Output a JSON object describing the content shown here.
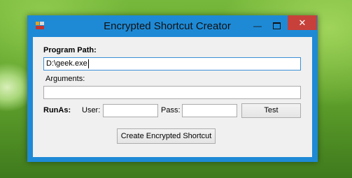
{
  "window": {
    "title": "Encrypted Shortcut Creator",
    "minimize_glyph": "—",
    "close_glyph": "✕",
    "accent_color": "#1e8ad6",
    "close_color": "#c7403a"
  },
  "form": {
    "program_path_label": "Program Path:",
    "program_path_value": "D:\\geek.exe",
    "arguments_label": "Arguments:",
    "arguments_value": "",
    "runas_label": "RunAs:",
    "user_label": "User:",
    "user_value": "",
    "pass_label": "Pass:",
    "pass_value": "",
    "test_button": "Test",
    "create_button": "Create Encrypted Shortcut"
  },
  "icons": {
    "app": "app-icon",
    "minimize": "minimize-icon",
    "maximize": "maximize-icon",
    "close": "close-icon"
  }
}
